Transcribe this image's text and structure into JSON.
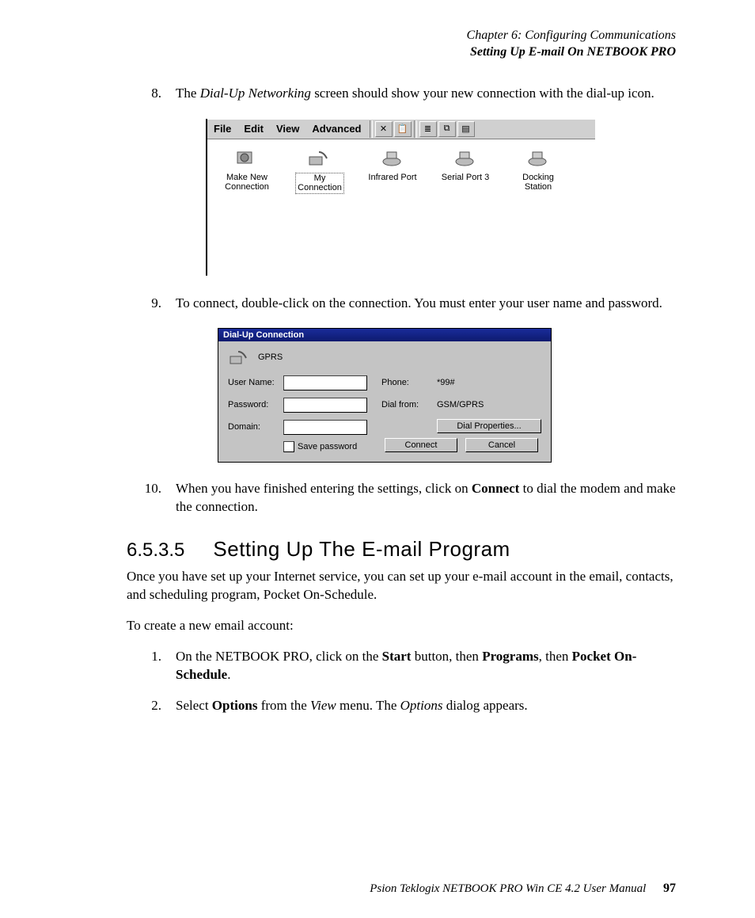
{
  "header": {
    "chapter": "Chapter 6:  Configuring Communications",
    "section": "Setting Up E-mail On NETBOOK PRO"
  },
  "steps_a": [
    {
      "n": "8.",
      "pre": "The ",
      "em": "Dial-Up Networking",
      "post": " screen should show your new connection with the dial-up icon."
    }
  ],
  "fm": {
    "menus": [
      "File",
      "Edit",
      "View",
      "Advanced"
    ],
    "tool_icons": [
      "✕",
      "📋",
      "≣",
      "⧉",
      "▤"
    ],
    "items": [
      {
        "label_l1": "Make New",
        "label_l2": "Connection",
        "sel": false
      },
      {
        "label_l1": "My",
        "label_l2": "Connection",
        "sel": true
      },
      {
        "label_l1": "Infrared Port",
        "label_l2": "",
        "sel": false
      },
      {
        "label_l1": "Serial Port 3",
        "label_l2": "",
        "sel": false
      },
      {
        "label_l1": "Docking",
        "label_l2": "Station",
        "sel": false
      }
    ]
  },
  "steps_b": [
    {
      "n": "9.",
      "text": "To connect, double-click on the connection. You must enter your user name and password."
    }
  ],
  "dialog": {
    "title": "Dial-Up Connection",
    "conn_name": "GPRS",
    "labels": {
      "user": "User Name:",
      "pass": "Password:",
      "domain": "Domain:",
      "save": "Save password",
      "phone": "Phone:",
      "dialfrom": "Dial from:"
    },
    "values": {
      "phone": "*99#",
      "dialfrom": "GSM/GPRS"
    },
    "buttons": {
      "dialprops": "Dial Properties...",
      "connect": "Connect",
      "cancel": "Cancel"
    }
  },
  "steps_c": [
    {
      "n": "10.",
      "pre": "When you have finished entering the settings, click on ",
      "b": "Connect",
      "post": " to dial the modem and make the connection."
    }
  ],
  "section": {
    "num": "6.5.3.5",
    "title": "Setting Up The E-mail Program"
  },
  "body": {
    "p1": "Once you have set up your Internet service, you can set up your e-mail account in the email, contacts, and scheduling program, Pocket On-Schedule.",
    "p2": "To create a new email account:"
  },
  "steps_d": [
    {
      "n": "1.",
      "parts": [
        {
          "t": "On the NETBOOK PRO, click on the "
        },
        {
          "b": "Start"
        },
        {
          "t": " button, then "
        },
        {
          "b": "Programs"
        },
        {
          "t": ", then "
        },
        {
          "b": "Pocket On-Schedule"
        },
        {
          "t": "."
        }
      ]
    },
    {
      "n": "2.",
      "parts": [
        {
          "t": "Select "
        },
        {
          "b": "Options"
        },
        {
          "t": " from the "
        },
        {
          "i": "View"
        },
        {
          "t": " menu. The "
        },
        {
          "i": "Options"
        },
        {
          "t": " dialog appears."
        }
      ]
    }
  ],
  "footer": {
    "text": "Psion Teklogix NETBOOK PRO Win CE 4.2 User Manual",
    "page": "97"
  }
}
